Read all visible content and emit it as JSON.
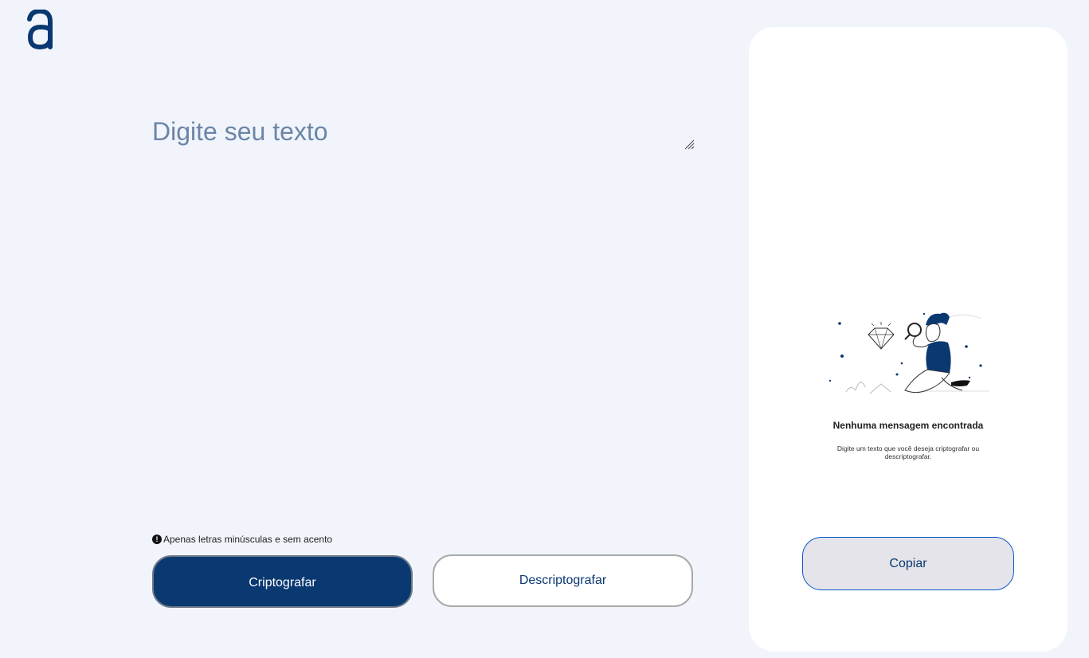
{
  "logo": {
    "letter": "a",
    "color": "#0a3871"
  },
  "input": {
    "placeholder": "Digite seu texto",
    "value": ""
  },
  "hint": {
    "icon": "info-icon",
    "text": "Apenas letras minúsculas e sem acento"
  },
  "buttons": {
    "encrypt_label": "Criptografar",
    "decrypt_label": "Descriptografar"
  },
  "output_panel": {
    "illustration": "person-with-magnifier-illustration",
    "empty_title": "Nenhuma mensagem encontrada",
    "empty_description": "Digite um texto que você deseja criptografar ou descriptografar.",
    "copy_label": "Copiar"
  },
  "colors": {
    "background": "#f1f4fb",
    "accent": "#0a3871",
    "placeholder": "#6b85a8",
    "panel": "#ffffff"
  }
}
